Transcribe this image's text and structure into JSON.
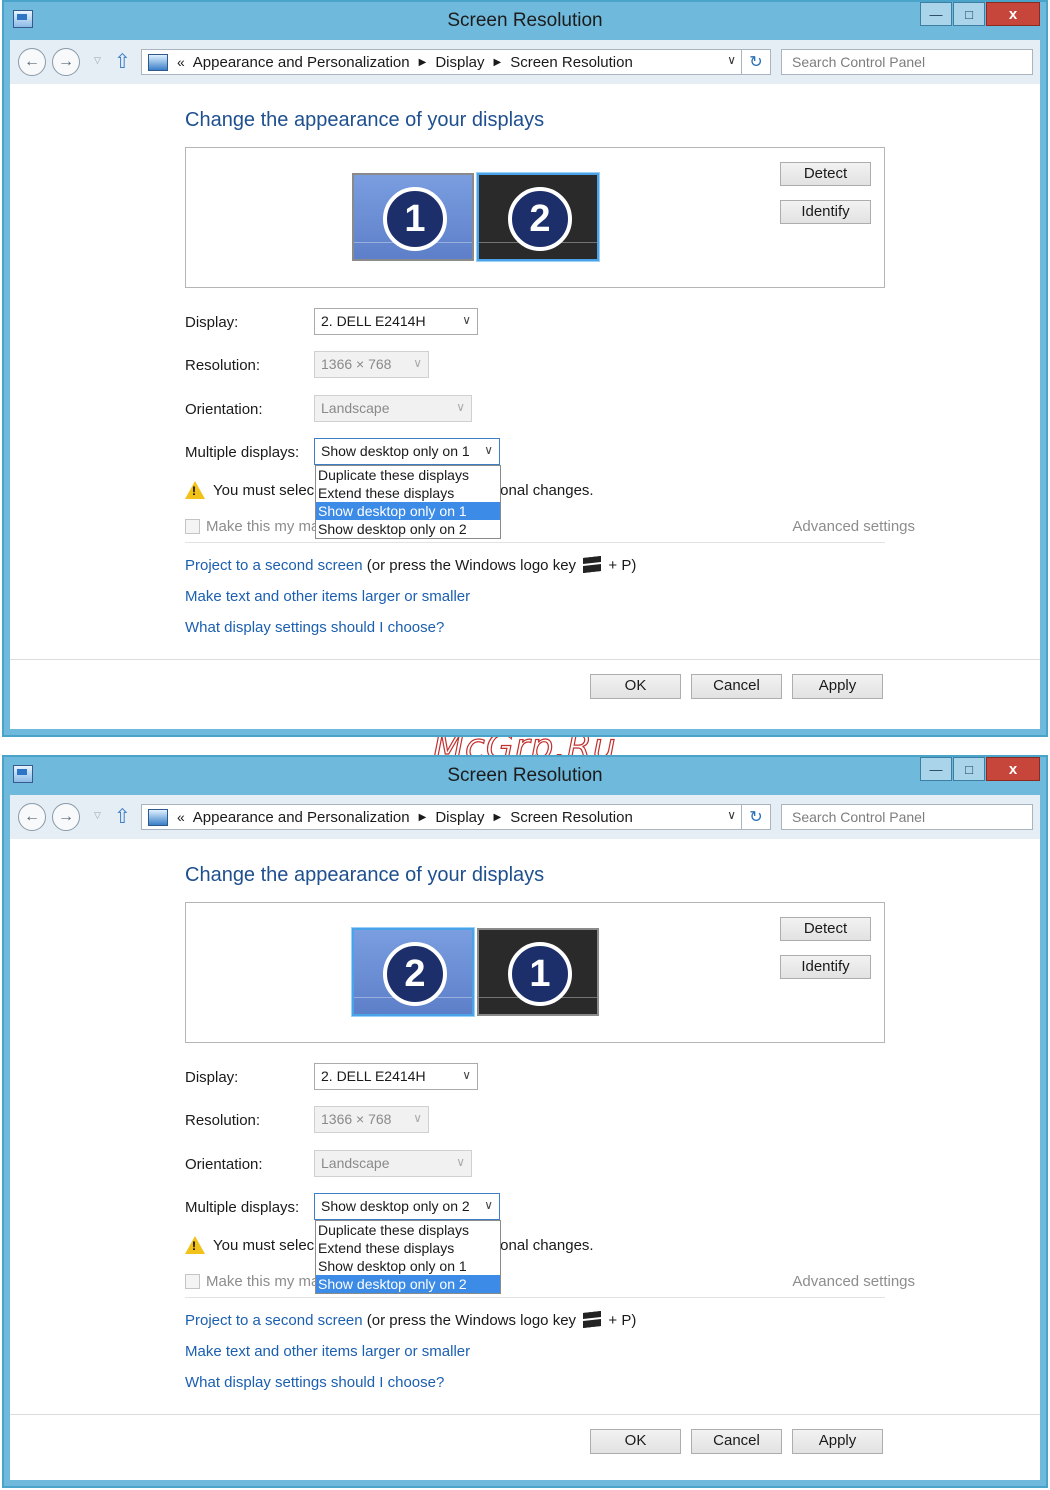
{
  "watermark": "McGrp.Ru",
  "colors": {
    "accent": "#3c8be6",
    "link": "#1b5fb0",
    "heading": "#1e4f8f",
    "title_bar": "#6fb9dc",
    "close": "#c6463b"
  },
  "windows": [
    {
      "title": "Screen Resolution",
      "caption": {
        "minimize": "—",
        "maximize": "□",
        "close": "x"
      },
      "breadcrumb": [
        "Appearance and Personalization",
        "Display",
        "Screen Resolution"
      ],
      "breadcrumb_prefix": "«",
      "search_placeholder": "Search Control Panel",
      "heading": "Change the appearance of your displays",
      "monitors": [
        {
          "number": "1",
          "style": "blue",
          "selected": false
        },
        {
          "number": "2",
          "style": "black",
          "selected": true
        }
      ],
      "detect_label": "Detect",
      "identify_label": "Identify",
      "display": {
        "label": "Display:",
        "value": "2. DELL E2414H"
      },
      "resolution": {
        "label": "Resolution:",
        "value": "1366 × 768"
      },
      "orientation": {
        "label": "Orientation:",
        "value": "Landscape"
      },
      "multiple": {
        "label": "Multiple displays:",
        "value": "Show desktop only on 1"
      },
      "menu_options": [
        "Duplicate these displays",
        "Extend these displays",
        "Show desktop only on 1",
        "Show desktop only on 2"
      ],
      "menu_highlight_index": 2,
      "warning_pre": "You must selec",
      "warning_post": "onal changes.",
      "checkbox_label": "Make this my ma",
      "advanced": "Advanced settings",
      "project_link": "Project to a second screen",
      "project_rest_pre": "(or press the Windows logo key",
      "project_rest_post": "+ P)",
      "text_link": "Make text and other items larger or smaller",
      "help_link": "What display settings should I choose?",
      "ok": "OK",
      "cancel": "Cancel",
      "apply": "Apply"
    },
    {
      "title": "Screen Resolution",
      "caption": {
        "minimize": "—",
        "maximize": "□",
        "close": "x"
      },
      "breadcrumb": [
        "Appearance and Personalization",
        "Display",
        "Screen Resolution"
      ],
      "breadcrumb_prefix": "«",
      "search_placeholder": "Search Control Panel",
      "heading": "Change the appearance of your displays",
      "monitors": [
        {
          "number": "2",
          "style": "blue",
          "selected": true
        },
        {
          "number": "1",
          "style": "black",
          "selected": false
        }
      ],
      "detect_label": "Detect",
      "identify_label": "Identify",
      "display": {
        "label": "Display:",
        "value": "2. DELL E2414H"
      },
      "resolution": {
        "label": "Resolution:",
        "value": "1366 × 768"
      },
      "orientation": {
        "label": "Orientation:",
        "value": "Landscape"
      },
      "multiple": {
        "label": "Multiple displays:",
        "value": "Show desktop only on 2"
      },
      "menu_options": [
        "Duplicate these displays",
        "Extend these displays",
        "Show desktop only on 1",
        "Show desktop only on 2"
      ],
      "menu_highlight_index": 3,
      "warning_pre": "You must selec",
      "warning_post": "onal changes.",
      "checkbox_label": "Make this my ma",
      "advanced": "Advanced settings",
      "project_link": "Project to a second screen",
      "project_rest_pre": "(or press the Windows logo key",
      "project_rest_post": "+ P)",
      "text_link": "Make text and other items larger or smaller",
      "help_link": "What display settings should I choose?",
      "ok": "OK",
      "cancel": "Cancel",
      "apply": "Apply"
    }
  ]
}
